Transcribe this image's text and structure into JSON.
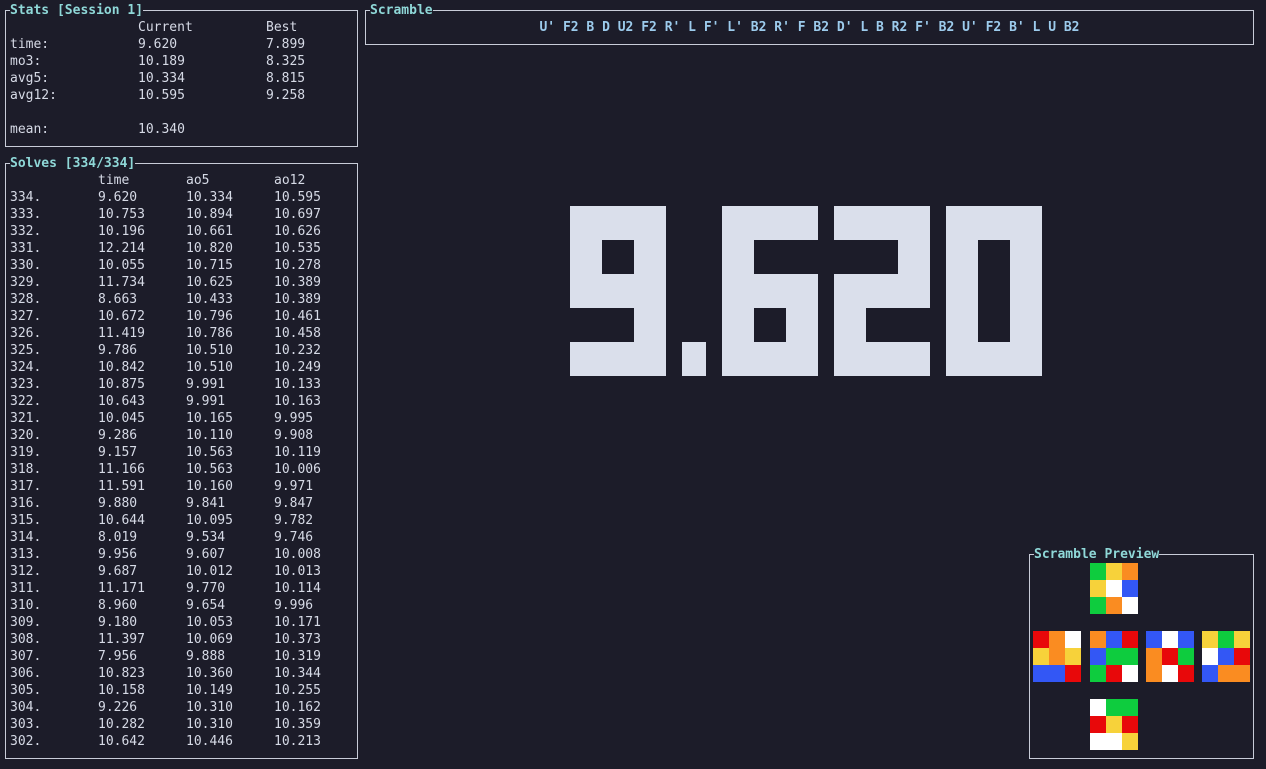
{
  "colors": {
    "background": "#1c1c29",
    "title": "#8fd8d8",
    "border": "#c8ccd8",
    "text": "#d6dae6",
    "scramble": "#9ccbec",
    "timer": "#dadfeb",
    "cube": {
      "W": "#ffffff",
      "Y": "#f7d23a",
      "G": "#0ecc3e",
      "B": "#3357f5",
      "R": "#e8080a",
      "O": "#fa8c21"
    }
  },
  "stats": {
    "title": "Stats [Session 1]",
    "col_current": "Current",
    "col_best": "Best",
    "rows": [
      {
        "label": "time:",
        "current": "9.620",
        "best": "7.899"
      },
      {
        "label": "mo3:",
        "current": "10.189",
        "best": "8.325"
      },
      {
        "label": "avg5:",
        "current": "10.334",
        "best": "8.815"
      },
      {
        "label": "avg12:",
        "current": "10.595",
        "best": "9.258"
      }
    ],
    "mean_label": "mean:",
    "mean_value": "10.340"
  },
  "solves": {
    "title": "Solves [334/334]",
    "headers": [
      "",
      "time",
      "ao5",
      "ao12"
    ],
    "rows": [
      [
        "334.",
        "9.620",
        "10.334",
        "10.595"
      ],
      [
        "333.",
        "10.753",
        "10.894",
        "10.697"
      ],
      [
        "332.",
        "10.196",
        "10.661",
        "10.626"
      ],
      [
        "331.",
        "12.214",
        "10.820",
        "10.535"
      ],
      [
        "330.",
        "10.055",
        "10.715",
        "10.278"
      ],
      [
        "329.",
        "11.734",
        "10.625",
        "10.389"
      ],
      [
        "328.",
        "8.663",
        "10.433",
        "10.389"
      ],
      [
        "327.",
        "10.672",
        "10.796",
        "10.461"
      ],
      [
        "326.",
        "11.419",
        "10.786",
        "10.458"
      ],
      [
        "325.",
        "9.786",
        "10.510",
        "10.232"
      ],
      [
        "324.",
        "10.842",
        "10.510",
        "10.249"
      ],
      [
        "323.",
        "10.875",
        "9.991",
        "10.133"
      ],
      [
        "322.",
        "10.643",
        "9.991",
        "10.163"
      ],
      [
        "321.",
        "10.045",
        "10.165",
        "9.995"
      ],
      [
        "320.",
        "9.286",
        "10.110",
        "9.908"
      ],
      [
        "319.",
        "9.157",
        "10.563",
        "10.119"
      ],
      [
        "318.",
        "11.166",
        "10.563",
        "10.006"
      ],
      [
        "317.",
        "11.591",
        "10.160",
        "9.971"
      ],
      [
        "316.",
        "9.880",
        "9.841",
        "9.847"
      ],
      [
        "315.",
        "10.644",
        "10.095",
        "9.782"
      ],
      [
        "314.",
        "8.019",
        "9.534",
        "9.746"
      ],
      [
        "313.",
        "9.956",
        "9.607",
        "10.008"
      ],
      [
        "312.",
        "9.687",
        "10.012",
        "10.013"
      ],
      [
        "311.",
        "11.171",
        "9.770",
        "10.114"
      ],
      [
        "310.",
        "8.960",
        "9.654",
        "9.996"
      ],
      [
        "309.",
        "9.180",
        "10.053",
        "10.171"
      ],
      [
        "308.",
        "11.397",
        "10.069",
        "10.373"
      ],
      [
        "307.",
        "7.956",
        "9.888",
        "10.319"
      ],
      [
        "306.",
        "10.823",
        "10.360",
        "10.344"
      ],
      [
        "305.",
        "10.158",
        "10.149",
        "10.255"
      ],
      [
        "304.",
        "9.226",
        "10.310",
        "10.162"
      ],
      [
        "303.",
        "10.282",
        "10.310",
        "10.359"
      ],
      [
        "302.",
        "10.642",
        "10.446",
        "10.213"
      ]
    ]
  },
  "scramble": {
    "title": "Scramble",
    "text": "U' F2 B D U2 F2 R' L F' L' B2 R' F B2 D' L B R2 F' B2 U' F2 B' L U B2"
  },
  "timer": {
    "display": "9.620"
  },
  "preview": {
    "title": "Scramble Preview",
    "faces": [
      {
        "name": "top",
        "stickers": [
          "G",
          "Y",
          "O",
          "Y",
          "W",
          "B",
          "G",
          "O",
          "W"
        ]
      },
      {
        "name": "left",
        "stickers": [
          "R",
          "O",
          "W",
          "Y",
          "O",
          "Y",
          "B",
          "B",
          "R"
        ]
      },
      {
        "name": "front",
        "stickers": [
          "O",
          "B",
          "R",
          "B",
          "G",
          "G",
          "G",
          "R",
          "W"
        ]
      },
      {
        "name": "right",
        "stickers": [
          "B",
          "W",
          "B",
          "O",
          "R",
          "G",
          "O",
          "W",
          "R"
        ]
      },
      {
        "name": "back",
        "stickers": [
          "Y",
          "G",
          "Y",
          "W",
          "B",
          "R",
          "B",
          "O",
          "O"
        ]
      },
      {
        "name": "bottom",
        "stickers": [
          "W",
          "G",
          "G",
          "R",
          "Y",
          "R",
          "W",
          "W",
          "Y"
        ]
      }
    ]
  }
}
